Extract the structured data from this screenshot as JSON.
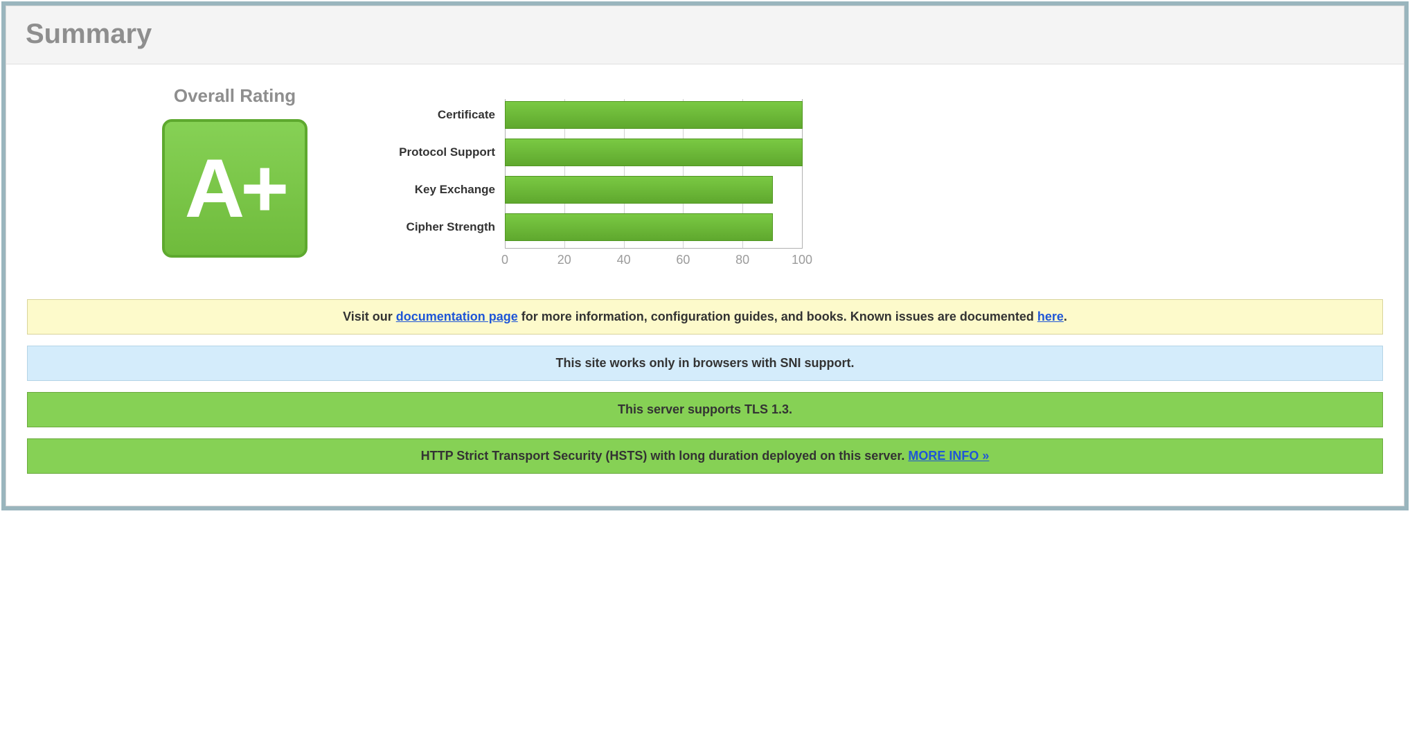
{
  "panel": {
    "title": "Summary"
  },
  "rating": {
    "label": "Overall Rating",
    "grade": "A+"
  },
  "chart_data": {
    "type": "bar",
    "orientation": "horizontal",
    "categories": [
      "Certificate",
      "Protocol Support",
      "Key Exchange",
      "Cipher Strength"
    ],
    "values": [
      100,
      100,
      90,
      90
    ],
    "xlabel": "",
    "ylabel": "",
    "xlim": [
      0,
      100
    ],
    "ticks": [
      0,
      20,
      40,
      60,
      80,
      100
    ],
    "bar_color": "#7ac943"
  },
  "notices": {
    "docs": {
      "prefix": "Visit our ",
      "link1": "documentation page",
      "middle": " for more information, configuration guides, and books. Known issues are documented ",
      "link2": "here",
      "suffix": "."
    },
    "sni": "This site works only in browsers with SNI support.",
    "tls": "This server supports TLS 1.3.",
    "hsts": {
      "text": "HTTP Strict Transport Security (HSTS) with long duration deployed on this server.  ",
      "link": "MORE INFO »"
    }
  }
}
